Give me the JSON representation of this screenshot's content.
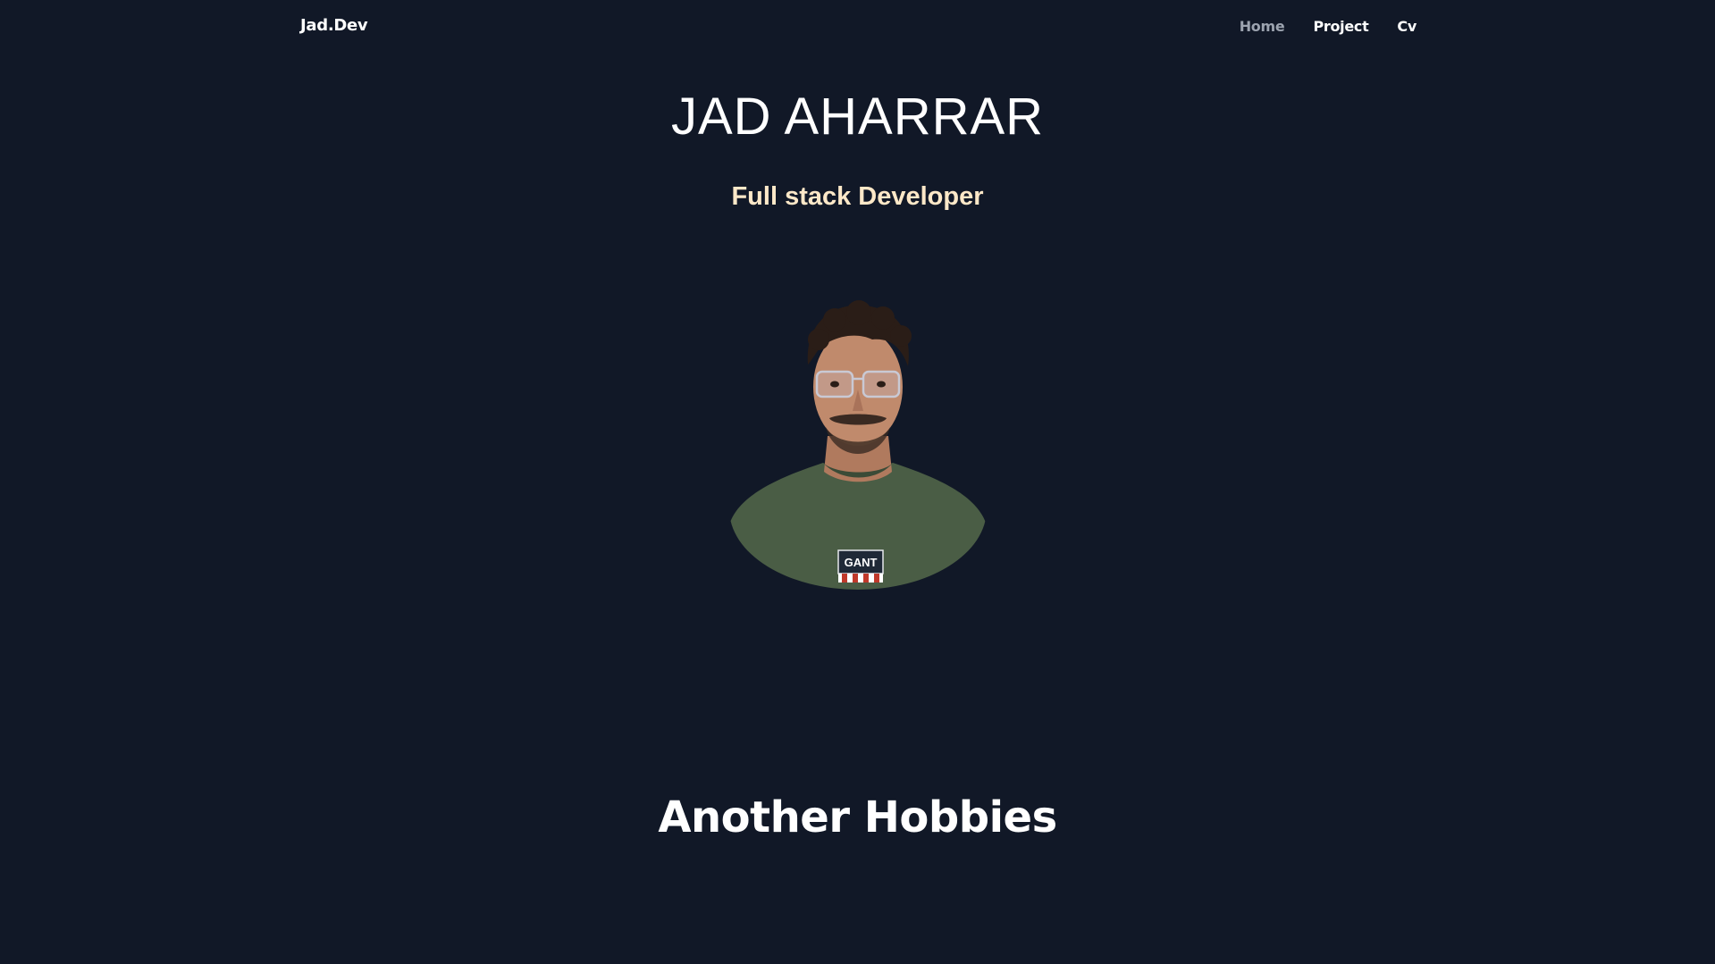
{
  "header": {
    "brand": "Jad.Dev",
    "nav": [
      {
        "label": "Home",
        "active": true
      },
      {
        "label": "Project",
        "active": false
      },
      {
        "label": "Cv",
        "active": false
      }
    ]
  },
  "hero": {
    "name": "JAD AHARRAR",
    "role": "Full stack Developer",
    "avatar_icon": "profile-photo"
  },
  "hobbies": {
    "title": "Another Hobbies"
  },
  "colors": {
    "background": "#111827",
    "text": "#ffffff",
    "nav_active": "#9ca3af",
    "role_text": "#fde8c8"
  }
}
